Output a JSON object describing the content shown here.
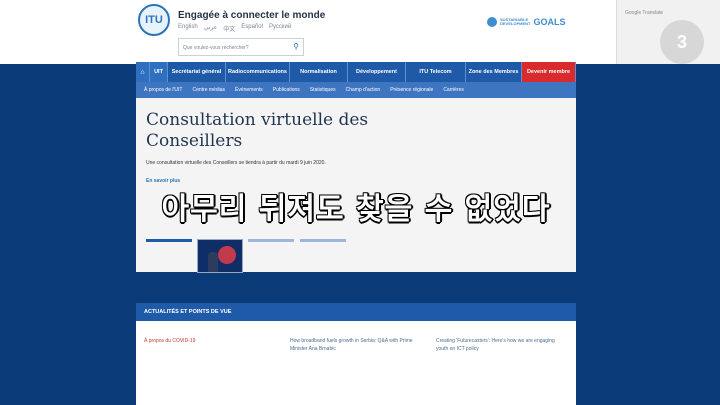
{
  "header": {
    "logo_text": "ITU",
    "tagline": "Engagée à connecter le monde",
    "languages": [
      "English",
      "عربي",
      "中文",
      "Español",
      "Русский"
    ],
    "search_placeholder": "Que voulez-vous rechercher?",
    "sdg": {
      "line1": "SUSTAINABLE",
      "line2": "DEVELOPMENT",
      "goals": "GOALS"
    },
    "google_translate": "Google Translate",
    "badge_text": "3"
  },
  "nav": {
    "primary": [
      "UIT",
      "Secrétariat général",
      "Radiocommunications",
      "Normalisation",
      "Développement",
      "ITU Telecom",
      "Zone des Membres",
      "Devenir membre"
    ],
    "secondary": [
      "À propos de l'UIT",
      "Centre médias",
      "Événements",
      "Publications",
      "Statistiques",
      "Champ d'action",
      "Présence régionale",
      "Carrières"
    ]
  },
  "hero": {
    "title": "Consultation virtuelle des Conseillers",
    "description": "Une consultation virtuelle des Conseillers se tiendra à partir du mardi 9 juin 2020.",
    "more": "En savoir plus",
    "caption": "아무리 뒤져도 찾을 수 없었다"
  },
  "section": {
    "title": "ACTUALITÉS ET POINTS DE VUE",
    "items": [
      "À propos du COVID-19",
      "How broadband fuels growth in Serbia: Q&A with Prime Minister Ana Brnabic",
      "Creating 'Futurecasters': Here's how we are engaging youth on ICT policy"
    ]
  },
  "colors": {
    "brand_blue": "#1e5aa8",
    "nav_sub_blue": "#3d75c1",
    "join_red": "#d92b2b",
    "background": "#0b3a78"
  }
}
